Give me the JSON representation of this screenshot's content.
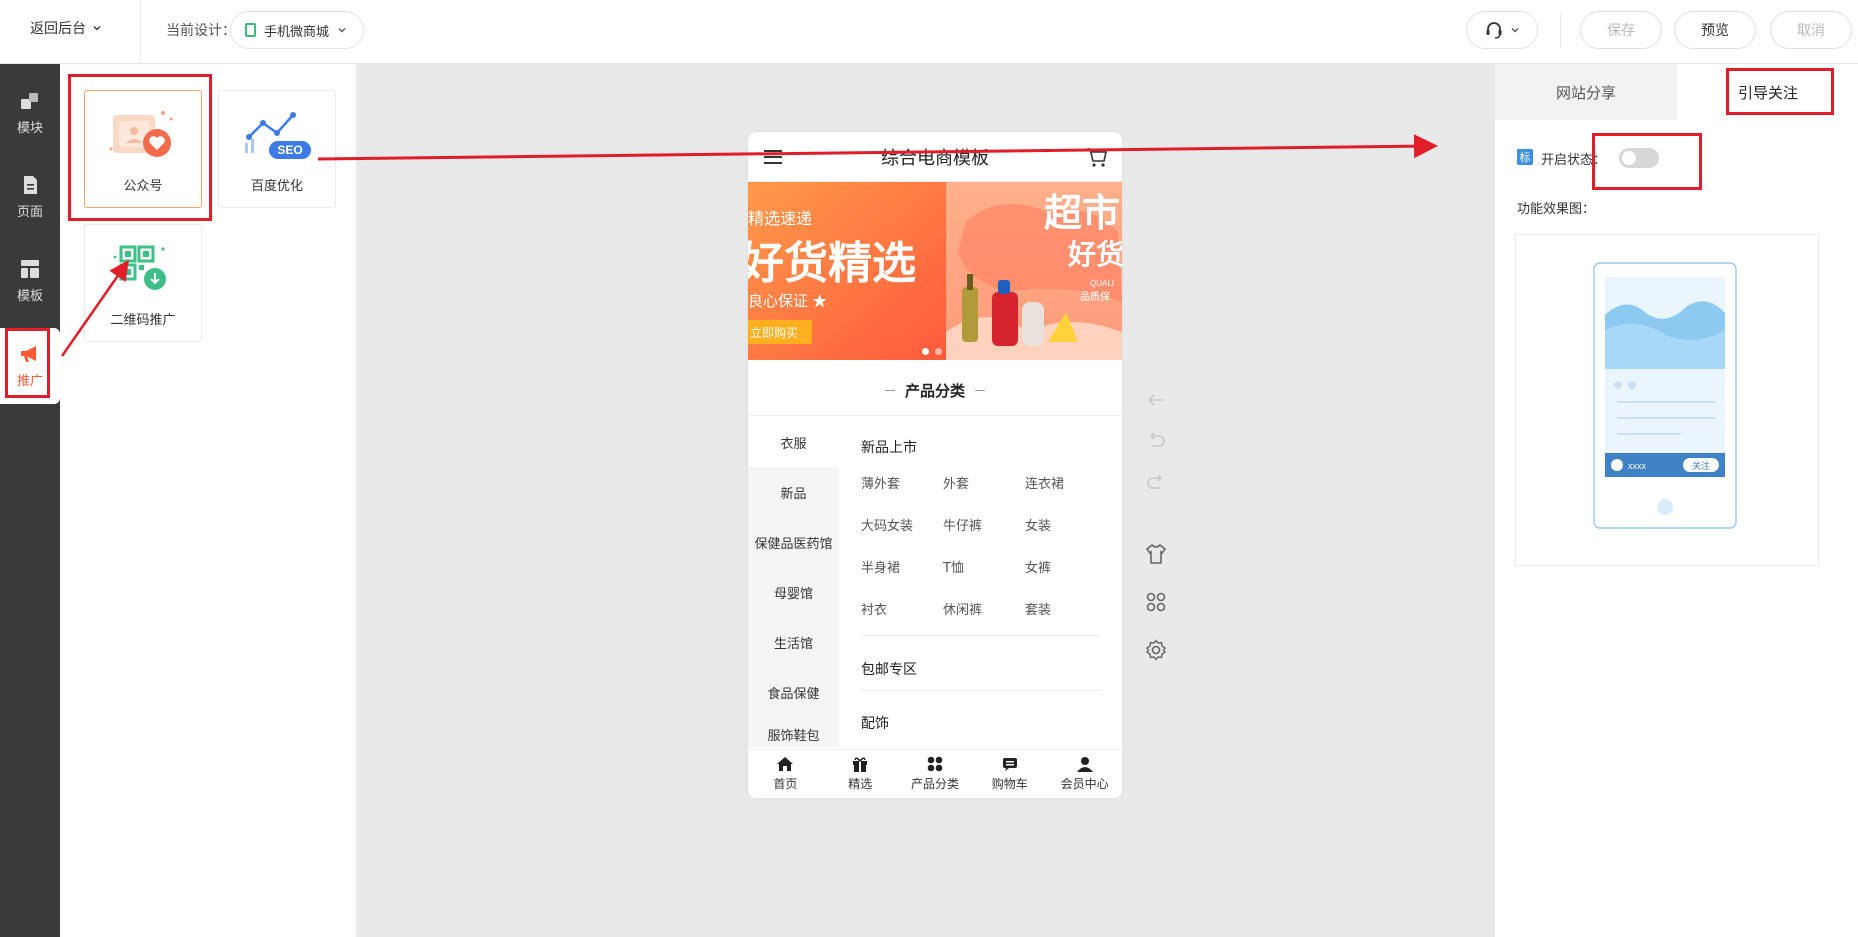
{
  "topbar": {
    "back_label": "返回后台",
    "current_design_label": "当前设计：",
    "design_name": "手机微商城",
    "save_label": "保存",
    "preview_label": "预览",
    "cancel_label": "取消"
  },
  "sidebar": {
    "items": [
      {
        "label": "模块",
        "icon": "module-icon"
      },
      {
        "label": "页面",
        "icon": "page-icon"
      },
      {
        "label": "模板",
        "icon": "template-icon"
      },
      {
        "label": "推广",
        "icon": "megaphone-icon"
      }
    ],
    "active_index": 3
  },
  "modules": [
    {
      "label": "公众号"
    },
    {
      "label": "百度优化",
      "badge": "SEO"
    },
    {
      "label": "二维码推广"
    }
  ],
  "phone": {
    "title": "综合电商模板",
    "banner": {
      "left_text_top": "精选速递",
      "left_text_big": "好货精选",
      "left_text_sub": "良心保证 ★",
      "left_button": "立即购买",
      "right_text_big1": "超市",
      "right_text_big2": "好货",
      "right_text_small1": "QUALI",
      "right_text_small2": "品质保"
    },
    "section_title": "产品分类",
    "left_categories": [
      "衣服",
      "新品",
      "保健品医药馆",
      "母婴馆",
      "生活馆",
      "食品保健",
      "服饰鞋包"
    ],
    "right": {
      "head1": "新品上市",
      "items": [
        "薄外套",
        "外套",
        "连衣裙",
        "大码女装",
        "牛仔裤",
        "女装",
        "半身裙",
        "T恤",
        "女裤",
        "衬衣",
        "休闲裤",
        "套装"
      ],
      "head2": "包邮专区",
      "head3": "配饰"
    },
    "tabs": [
      "首页",
      "精选",
      "产品分类",
      "购物车",
      "会员中心"
    ]
  },
  "right_panel": {
    "tabs": [
      "网站分享",
      "引导关注"
    ],
    "active_tab": 1,
    "tag": "标",
    "state_label": "开启状态：",
    "toggle_on": false,
    "effect_label": "功能效果图：",
    "preview_user_text": "xxxx",
    "preview_button": "关注"
  },
  "colors": {
    "accent": "#ff5a36",
    "annotation_red": "#e01e2a",
    "toggle_off": "#d7d7d7",
    "tag_blue": "#3a8ee6"
  }
}
